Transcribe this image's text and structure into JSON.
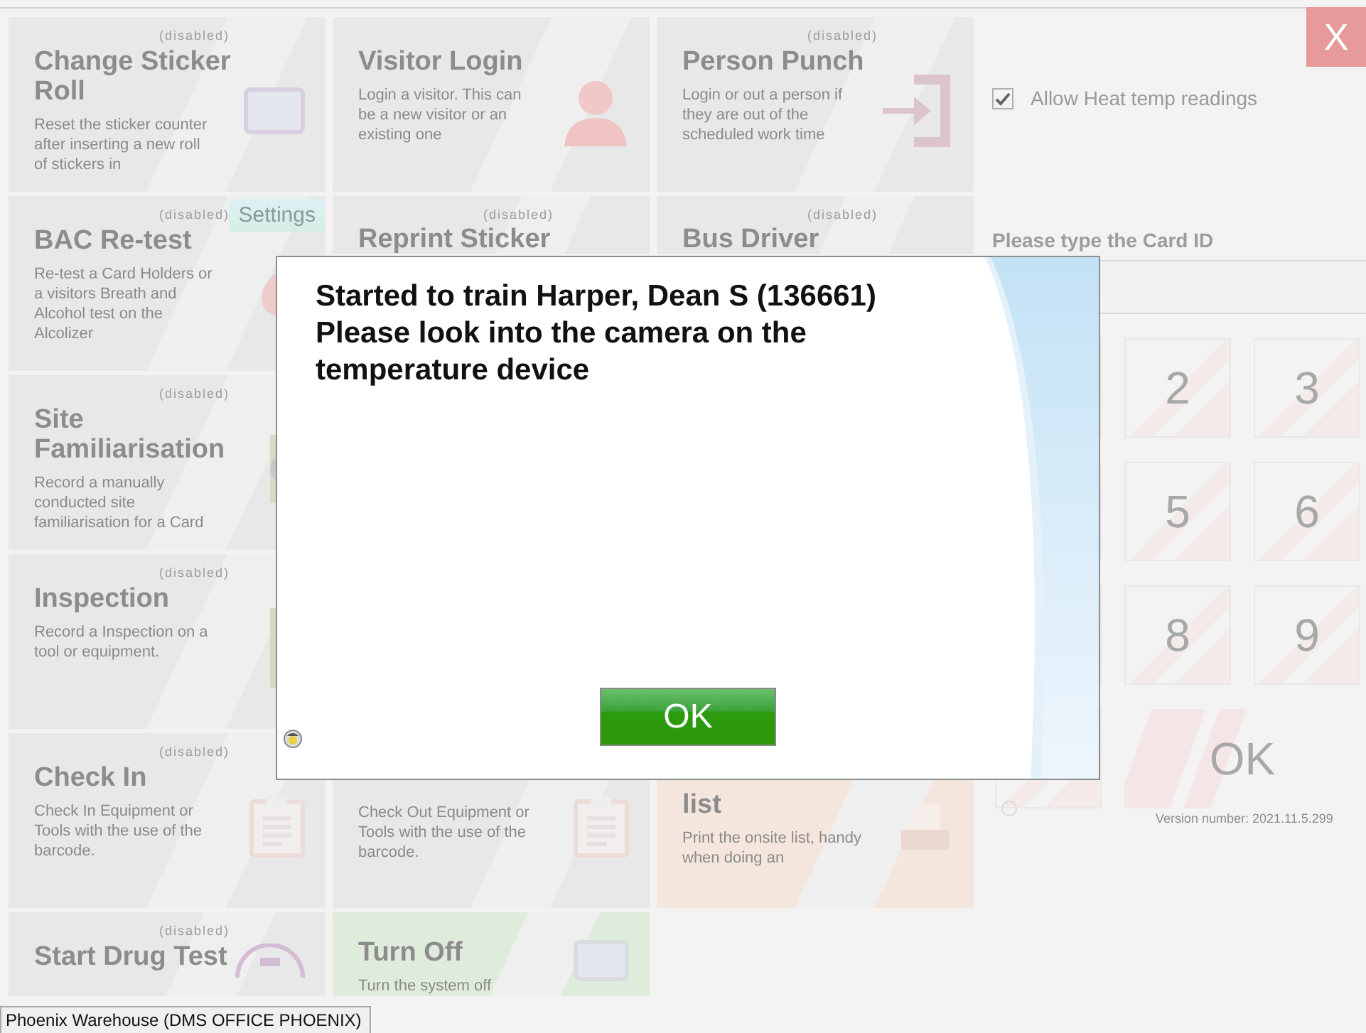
{
  "tiles": [
    {
      "title": "Change Sticker Roll",
      "status": "(disabled)",
      "description": "Reset the sticker counter after inserting a new roll of stickers in",
      "color": "#e8e8e8"
    },
    {
      "title": "Visitor Login",
      "description": "Login a visitor. This can be a new visitor or an existing one",
      "color": "#e8e8e8"
    },
    {
      "title": "Person Punch",
      "status": "(disabled)",
      "description": "Login or out a person if they are out of the scheduled work time",
      "color": "#e8e8e8"
    },
    {
      "title": "BAC Re-test",
      "status": "(disabled)",
      "description": "Re-test a Card Holders or a visitors Breath and Alcohol test on the Alcolizer",
      "color": "#e8e8e8",
      "button": "Settings"
    },
    {
      "title": "Reprint Sticker",
      "status": "(disabled)",
      "color": "#e8e8e8"
    },
    {
      "title": "Bus Driver",
      "status": "(disabled)",
      "color": "#e8e8e8"
    },
    {
      "title": "Site Familiarisation",
      "status": "(disabled)",
      "description": "Record a manually conducted site familiarisation for a Card",
      "color": "#e8e8e8"
    },
    {
      "title": "Inspection",
      "status": "(disabled)",
      "description": "Record a Inspection on a tool or equipment.",
      "color": "#e8e8e8"
    },
    {
      "title": "Check In",
      "status": "(disabled)",
      "description": "Check In Equipment or Tools with the use of the barcode.",
      "color": "#e8e8e8"
    },
    {
      "description": "Check Out Equipment or Tools with the use of the barcode.",
      "color": "#e8e8e8"
    },
    {
      "title": "list",
      "description": "Print the onsite list, handy when doing an",
      "color": "#f4e6dc"
    },
    {
      "title": "Start Drug Test",
      "status": "(disabled)",
      "color": "#e8e8e8"
    },
    {
      "title": "Turn Off",
      "description": "Turn the system off",
      "color": "#dfecdc"
    }
  ],
  "panel": {
    "close": "X",
    "checkbox": {
      "label": "Allow Heat temp readings",
      "checked": true
    },
    "card_label": "Please type the Card ID",
    "keys": [
      "2",
      "3",
      "5",
      "6",
      "8",
      "9"
    ],
    "ok": "OK",
    "version": "Version number: 2021.11.5.299"
  },
  "dialog": {
    "lines": [
      "Started to train Harper, Dean S (136661)",
      "Please look into the camera on the",
      "temperature device"
    ],
    "button": "OK"
  },
  "status_bar": "Phoenix Warehouse (DMS OFFICE PHOENIX)"
}
